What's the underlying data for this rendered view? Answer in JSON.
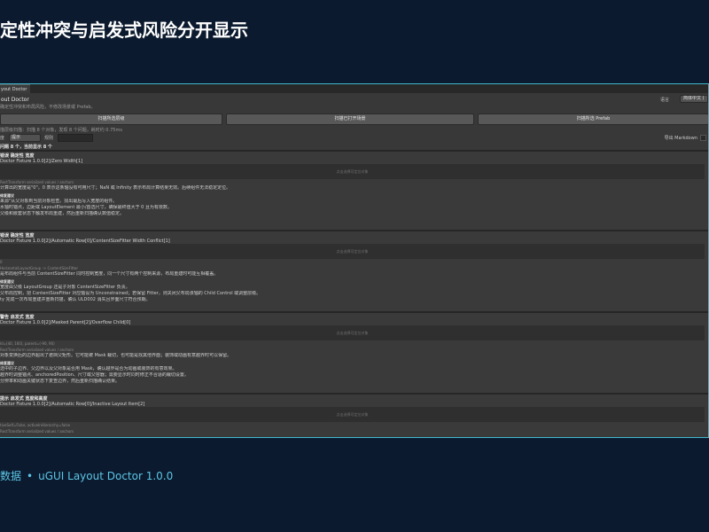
{
  "slide": {
    "title": "定性冲突与启发式风险分开显示",
    "footer_left": "数据",
    "footer_sep": "•",
    "footer_right": "uGUI Layout Doctor 1.0.0"
  },
  "window": {
    "tab": "yout Doctor",
    "title": "out Doctor",
    "subtitle": "确定性冲突和布局风险，不修改场景或 Prefab。",
    "language_label": "语言",
    "language_value": "简体中文 (",
    "buttons": [
      "扫描所选层级",
      "扫描已打开场景",
      "扫描所选 Prefab"
    ],
    "scan_info": "描层级扫描：扫描 8 个对象，发现 8 个问题，耗时约 0.75ms",
    "filters": {
      "severity_label": "度",
      "severity_value": "提示",
      "rule_label": "规则",
      "export_label": "导出 Markdown"
    },
    "summary": "问题 8 个，当前显示 8 个"
  },
  "cards": [
    {
      "head": "错误  确定性  宽度",
      "path": "Doctor Fixture 1.0.0[2]/Zero Width[1]",
      "preview": "点击选择可定位对象",
      "lines": [
        "RectTransform serialized values / anchors",
        "计算出的宽度是\"0\"。0 表示这条轴没有可用尺寸；NaN 或 Infinity 表示布局计算结果无效。后续组件无法稳定定位。"
      ],
      "section": "修复建议",
      "fixes": [
        "来源\"从父对象到当前对象检查。找出最后写入宽度的组件。",
        "水轴时锚点，边距或 LayoutElement 最小/首选尺寸，确保最终值大于 0 且为有限数。",
        "父级和嵌套状态下触发布局重建，然后重新扫描确认数值稳定。"
      ]
    },
    {
      "head": "错误  确定性  宽度",
      "path": "Doctor Fixture 1.0.0[2]/Automatic Row[0]/ContentSizeFitter Width Conflict[1]",
      "preview": "点击选择可定位对象",
      "lines": [
        "0",
        "HorizontalLayoutGroup -> ContentSizeFitter",
        "是布局组件与当前 ContentSizeFitter 同时控制宽度，同一个尺寸有两个控制来源，布局重建时可能互相覆盖。"
      ],
      "section": "修复建议",
      "fixes": [
        "宽度由父级 LayoutGroup 还是子对象 ContentSizeFitter 负责。",
        "父布局控制，把 ContentSizeFitter 对应轴设为 Unconstrained；若保留 Fitter，则关闭父布局该轴的 Child Control 或调整层级。",
        "ty 完成一次布局重建并重新扫描，确认 ULD002 消失且界面尺寸符合预期。"
      ]
    },
    {
      "head": "警告  启发式  宽度",
      "path": "Doctor Fixture 1.0.0[2]/Masked Parent[2]/Overflow Child[0]",
      "preview": "点击选择可定位对象",
      "lines": [
        "ld=(40, 160), parent=(-90, 90)",
        "RectTransform serialized values / anchors",
        "对象变换后的边界超出了遮挡父矩形。它可能被 Mask 裁切，也可能是找其他界面；装饰或动画有意越界时可以保留。"
      ],
      "section": "修复建议",
      "fixes": [
        "选中的子边界、父边界以及父对象是否用 Mask，确认越界是否为动画或装饰的有意效果。",
        "越界时调整锚点、anchoredPosition、尺寸或父容器；需要显示时同时修正不合适的裁切设置。",
        "分辨率和动画关键状态下复查边界，然后重新扫描确认结果。"
      ]
    },
    {
      "head": "提示  启发式  宽度和高度",
      "path": "Doctor Fixture 1.0.0[2]/Automatic Row[0]/Inactive Layout Item[2]",
      "preview": "点击选择可定位对象",
      "lines": [
        "tiveSelf=False, activeInHierarchy=false",
        "RectTransform serialized values / anchors"
      ],
      "section": "",
      "fixes": []
    }
  ],
  "colors": {
    "background": "#0b1a2e",
    "accent": "#3fb6c9",
    "footer": "#5cc6e6",
    "panel": "#383838"
  }
}
